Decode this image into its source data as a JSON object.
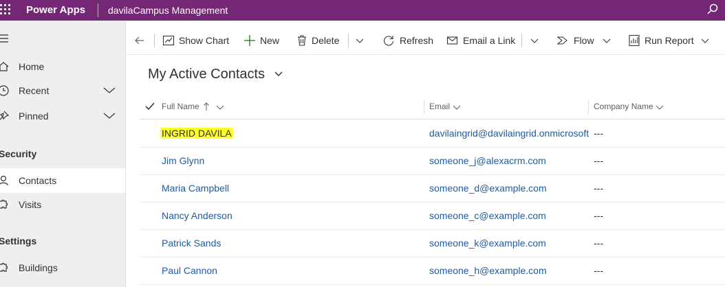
{
  "topbar": {
    "brand": "Power Apps",
    "app_name": "davilaCampus Management"
  },
  "sidebar": {
    "items": [
      {
        "label": "Home",
        "icon": "home-icon"
      },
      {
        "label": "Recent",
        "icon": "clock-icon"
      },
      {
        "label": "Pinned",
        "icon": "pin-icon"
      }
    ],
    "groups": [
      {
        "title": "Security",
        "items": [
          {
            "label": "Contacts",
            "icon": "person-icon",
            "selected": true
          },
          {
            "label": "Visits",
            "icon": "puzzle-icon"
          }
        ]
      },
      {
        "title": "Settings",
        "items": [
          {
            "label": "Buildings",
            "icon": "puzzle-icon"
          }
        ]
      }
    ]
  },
  "commandbar": {
    "show_chart": "Show Chart",
    "new": "New",
    "delete": "Delete",
    "refresh": "Refresh",
    "email_link": "Email a Link",
    "flow": "Flow",
    "run_report": "Run Report"
  },
  "view": {
    "title": "My Active Contacts"
  },
  "grid": {
    "columns": {
      "full_name": "Full Name",
      "email": "Email",
      "company": "Company Name"
    },
    "rows": [
      {
        "name": "INGRID DAVILA",
        "email": "davilaingrid@davilaingrid.onmicrosoft.com",
        "company": "---",
        "highlighted": true
      },
      {
        "name": "Jim Glynn",
        "email": "someone_j@alexacrm.com",
        "company": "---"
      },
      {
        "name": "Maria Campbell",
        "email": "someone_d@example.com",
        "company": "---"
      },
      {
        "name": "Nancy Anderson",
        "email": "someone_c@example.com",
        "company": "---"
      },
      {
        "name": "Patrick Sands",
        "email": "someone_k@example.com",
        "company": "---"
      },
      {
        "name": "Paul Cannon",
        "email": "someone_h@example.com",
        "company": "---"
      }
    ]
  },
  "colors": {
    "topbar": "#742774",
    "link": "#1f5b9e",
    "highlight": "#ffff29",
    "sidebar_bg": "#efefef"
  }
}
